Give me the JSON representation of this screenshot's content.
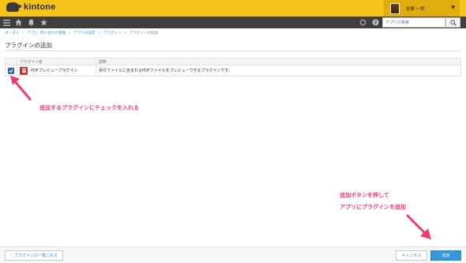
{
  "app": {
    "logo_text": "kintone"
  },
  "header": {
    "user_name": "佐藤 一郎",
    "search_placeholder": "アプリの検索"
  },
  "nav": {
    "icons": [
      "menu-icon",
      "home-icon",
      "notification-icon",
      "star-icon",
      "settings-icon",
      "help-icon",
      "search-icon"
    ]
  },
  "breadcrumb": {
    "items": [
      "ポータル",
      "アプリ: 問い合わせ管理",
      "アプリの設定",
      "プラグイン",
      "プラグインの追加"
    ]
  },
  "page": {
    "title": "プラグインの追加"
  },
  "table": {
    "headers": [
      "プラグイン名",
      "説明"
    ],
    "rows": [
      {
        "checked": true,
        "name": "PDFプレビュープラグイン",
        "description": "添付ファイルに含まれるPDFファイルをプレビューできるプラグインです。"
      }
    ]
  },
  "annotations": {
    "check_note": "追加するプラグインにチェックを入れる",
    "add_note_line1": "追加ボタンを押して",
    "add_note_line2": "アプリにプラグインを追加"
  },
  "footer": {
    "back_label": "プラグインの一覧に戻る",
    "cancel_label": "キャンセル",
    "add_label": "追加"
  },
  "colors": {
    "topbar": "#f6c31b",
    "navbar": "#3e3e3e",
    "accent": "#3498db",
    "annotation": "#ee3c6e"
  }
}
